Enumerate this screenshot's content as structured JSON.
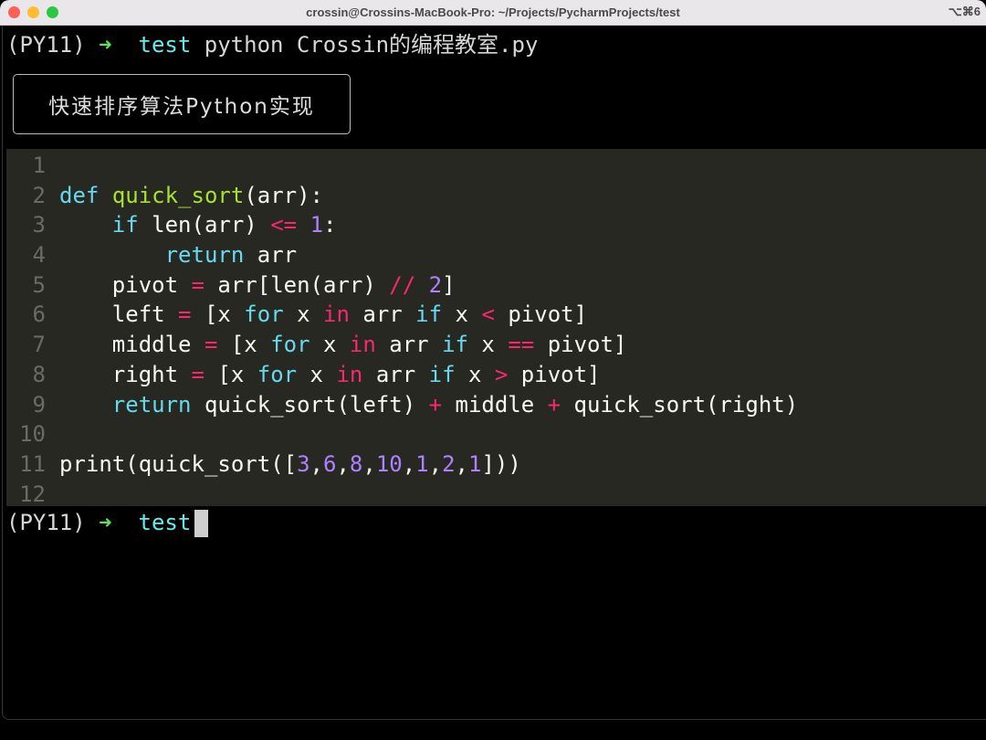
{
  "window": {
    "title": "crossin@Crossins-MacBook-Pro: ~/Projects/PycharmProjects/test",
    "shortcut": "⌥⌘6",
    "traffic_lights": [
      "#ff5f57",
      "#febc2e",
      "#28c840"
    ]
  },
  "prompt1": {
    "env": "(PY11)",
    "arrow": "➜",
    "dir": "test",
    "command": "python Crossin的编程教室.py"
  },
  "tag": "快速排序算法Python实现",
  "code": {
    "colors": {
      "plain": "#f8f8f2",
      "kw": "#66d9ef",
      "fn": "#a6e22e",
      "op": "#f92672",
      "num": "#ae81ff"
    },
    "lines": [
      {
        "n": "1",
        "t": []
      },
      {
        "n": "2",
        "t": [
          [
            "def",
            "kw"
          ],
          [
            " ",
            "plain"
          ],
          [
            "quick_sort",
            "fn"
          ],
          [
            "(arr):",
            "plain"
          ]
        ]
      },
      {
        "n": "3",
        "t": [
          [
            "    ",
            "plain"
          ],
          [
            "if",
            "kw"
          ],
          [
            " len(arr) ",
            "plain"
          ],
          [
            "<=",
            "op"
          ],
          [
            " ",
            "plain"
          ],
          [
            "1",
            "num"
          ],
          [
            ":",
            "plain"
          ]
        ]
      },
      {
        "n": "4",
        "t": [
          [
            "        ",
            "plain"
          ],
          [
            "return",
            "kw"
          ],
          [
            " arr",
            "plain"
          ]
        ]
      },
      {
        "n": "5",
        "t": [
          [
            "    pivot ",
            "plain"
          ],
          [
            "=",
            "op"
          ],
          [
            " arr[len(arr) ",
            "plain"
          ],
          [
            "//",
            "op"
          ],
          [
            " ",
            "plain"
          ],
          [
            "2",
            "num"
          ],
          [
            "]",
            "plain"
          ]
        ]
      },
      {
        "n": "6",
        "t": [
          [
            "    left ",
            "plain"
          ],
          [
            "=",
            "op"
          ],
          [
            " [x ",
            "plain"
          ],
          [
            "for",
            "kw"
          ],
          [
            " x ",
            "plain"
          ],
          [
            "in",
            "op"
          ],
          [
            " arr ",
            "plain"
          ],
          [
            "if",
            "kw"
          ],
          [
            " x ",
            "plain"
          ],
          [
            "<",
            "op"
          ],
          [
            " pivot]",
            "plain"
          ]
        ]
      },
      {
        "n": "7",
        "t": [
          [
            "    middle ",
            "plain"
          ],
          [
            "=",
            "op"
          ],
          [
            " [x ",
            "plain"
          ],
          [
            "for",
            "kw"
          ],
          [
            " x ",
            "plain"
          ],
          [
            "in",
            "op"
          ],
          [
            " arr ",
            "plain"
          ],
          [
            "if",
            "kw"
          ],
          [
            " x ",
            "plain"
          ],
          [
            "==",
            "op"
          ],
          [
            " pivot]",
            "plain"
          ]
        ]
      },
      {
        "n": "8",
        "t": [
          [
            "    right ",
            "plain"
          ],
          [
            "=",
            "op"
          ],
          [
            " [x ",
            "plain"
          ],
          [
            "for",
            "kw"
          ],
          [
            " x ",
            "plain"
          ],
          [
            "in",
            "op"
          ],
          [
            " arr ",
            "plain"
          ],
          [
            "if",
            "kw"
          ],
          [
            " x ",
            "plain"
          ],
          [
            ">",
            "op"
          ],
          [
            " pivot]",
            "plain"
          ]
        ]
      },
      {
        "n": "9",
        "t": [
          [
            "    ",
            "plain"
          ],
          [
            "return",
            "kw"
          ],
          [
            " quick_sort(left) ",
            "plain"
          ],
          [
            "+",
            "op"
          ],
          [
            " middle ",
            "plain"
          ],
          [
            "+",
            "op"
          ],
          [
            " quick_sort(right)",
            "plain"
          ]
        ]
      },
      {
        "n": "10",
        "t": []
      },
      {
        "n": "11",
        "t": [
          [
            "print(quick_sort([",
            "plain"
          ],
          [
            "3",
            "num"
          ],
          [
            ",",
            "plain"
          ],
          [
            "6",
            "num"
          ],
          [
            ",",
            "plain"
          ],
          [
            "8",
            "num"
          ],
          [
            ",",
            "plain"
          ],
          [
            "10",
            "num"
          ],
          [
            ",",
            "plain"
          ],
          [
            "1",
            "num"
          ],
          [
            ",",
            "plain"
          ],
          [
            "2",
            "num"
          ],
          [
            ",",
            "plain"
          ],
          [
            "1",
            "num"
          ],
          [
            "]))",
            "plain"
          ]
        ]
      },
      {
        "n": "12",
        "t": []
      }
    ]
  },
  "prompt2": {
    "env": "(PY11)",
    "arrow": "➜",
    "dir": "test"
  }
}
